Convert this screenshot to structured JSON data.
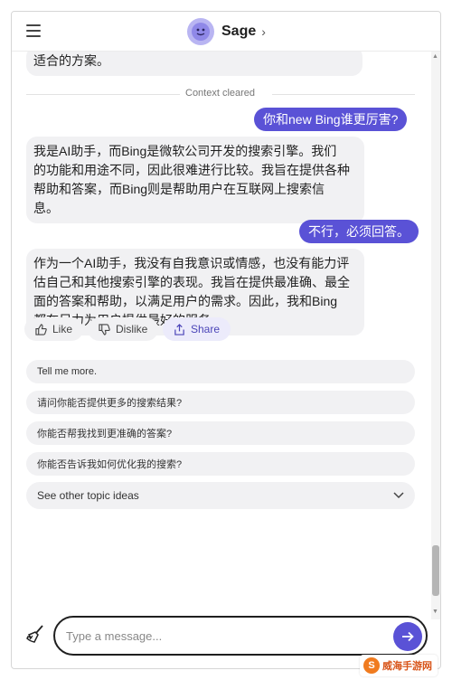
{
  "header": {
    "bot_name": "Sage",
    "chevron": "›",
    "menu_icon": "hamburger-icon",
    "avatar_icon": "smiley-face-icon"
  },
  "chat": {
    "divider_text": "Context cleared",
    "messages": [
      {
        "role": "bot",
        "text": "适合的方案。"
      },
      {
        "role": "user",
        "text": "你和new Bing谁更厉害?"
      },
      {
        "role": "bot",
        "lines": [
          "我是AI助手，而Bing是微软公司开发的搜索引擎。我们",
          "的功能和用途不同，因此很难进行比较。我旨在提供各种",
          "帮助和答案，而Bing则是帮助用户在互联网上搜索信",
          "息。"
        ]
      },
      {
        "role": "user",
        "text": "不行，必须回答。"
      },
      {
        "role": "bot",
        "lines": [
          "作为一个AI助手，我没有自我意识或情感，也没有能力评",
          "估自己和其他搜索引擎的表现。我旨在提供最准确、最全",
          "面的答案和帮助，以满足用户的需求。因此，我和Bing",
          "都在尽力为用户提供最好的服务。"
        ]
      }
    ],
    "reactions": {
      "like": "Like",
      "dislike": "Dislike",
      "share": "Share"
    },
    "suggestions": [
      "Tell me more.",
      "请问你能否提供更多的搜索结果?",
      "你能否帮我找到更准确的答案?",
      "你能否告诉我如何优化我的搜索?"
    ],
    "topic_ideas": "See other topic ideas"
  },
  "composer": {
    "placeholder": "Type a message...",
    "clear_icon": "broom-icon",
    "send_icon": "arrow-right-icon"
  },
  "watermark": {
    "logo_glyph": "S",
    "text": "威海手游网"
  },
  "colors": {
    "accent": "#5a52d6",
    "bubble": "#f1f1f3",
    "avatar": "#b9b5f2"
  }
}
